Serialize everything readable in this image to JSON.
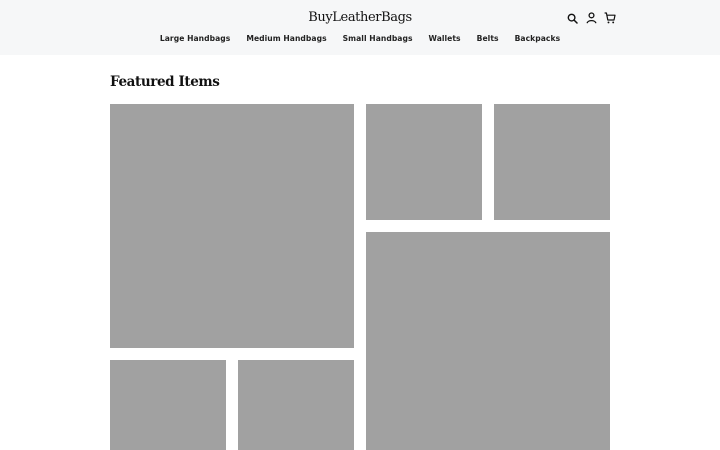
{
  "header": {
    "brand": "BuyLeatherBags",
    "icons": [
      "search-icon",
      "user-icon",
      "cart-icon"
    ],
    "nav": [
      "Large Handbags",
      "Medium Handbags",
      "Small Handbags",
      "Wallets",
      "Belts",
      "Backpacks"
    ]
  },
  "main": {
    "section_title": "Featured Items"
  },
  "colors": {
    "header_bg": "#f6f7f8",
    "placeholder": "#a1a1a1",
    "text": "#111111"
  }
}
